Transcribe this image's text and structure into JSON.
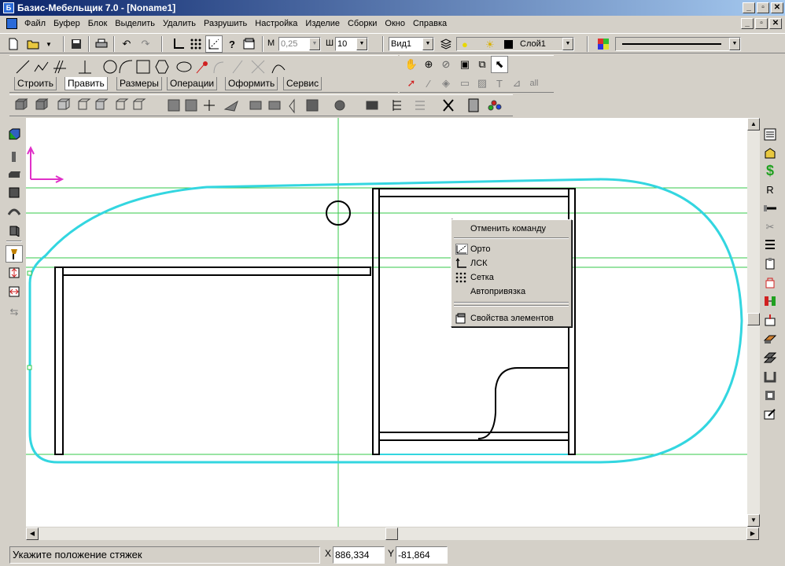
{
  "window": {
    "title": "Базис-Мебельщик 7.0 - [Noname1]",
    "buttons": [
      "_",
      "▫",
      "✕"
    ]
  },
  "menu": {
    "items": [
      "Файл",
      "Буфер",
      "Блок",
      "Выделить",
      "Удалить",
      "Разрушить",
      "Настройка",
      "Изделие",
      "Сборки",
      "Окно",
      "Справка"
    ],
    "doc_buttons": [
      "_",
      "▫",
      "✕"
    ]
  },
  "toolbar": {
    "m_label": "М",
    "m_value": "0,25",
    "sh_label": "Ш",
    "sh_value": "10",
    "view_value": "Вид1",
    "layer_value": "Слой1",
    "help_glyph": "?"
  },
  "tabs": [
    "Строить",
    "Править",
    "Размеры",
    "Операции",
    "Оформить",
    "Сервис"
  ],
  "draw_tools": {
    "all_label": "all"
  },
  "right_tools": {
    "dollar_glyph": "$",
    "r_glyph": "R"
  },
  "context_menu": {
    "items": [
      {
        "label": "Отменить команду",
        "icon": "none"
      },
      {
        "label": "Орто",
        "icon": "ortho-icon"
      },
      {
        "label": "ЛСК",
        "icon": "lsk-icon"
      },
      {
        "label": "Сетка",
        "icon": "grid-icon"
      },
      {
        "label": "Автопривязка",
        "icon": "none"
      },
      {
        "label": "Свойства элементов",
        "icon": "properties-icon"
      }
    ]
  },
  "status": {
    "message": "Укажите положение стяжек",
    "x_label": "X",
    "x_value": "886,334",
    "y_label": "Y",
    "y_value": "-81,864"
  },
  "colors": {
    "title_start": "#0a246a",
    "title_end": "#a6caf0",
    "outline_cyan": "#33d6e0",
    "guide_green": "#35c94a",
    "axis_magenta": "#e030c8",
    "face": "#d4d0c8"
  }
}
